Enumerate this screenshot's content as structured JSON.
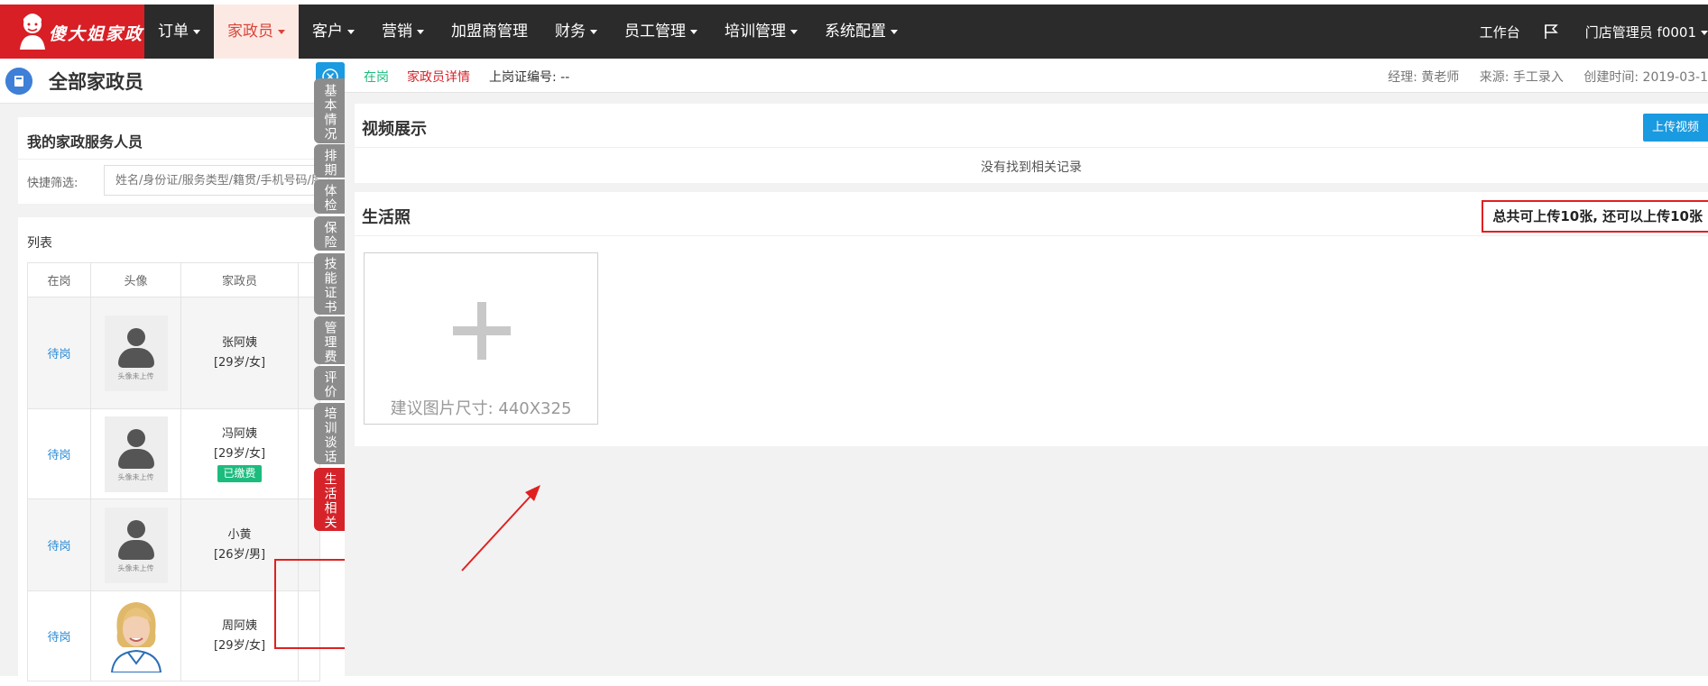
{
  "nav": {
    "brand": "傻大姐家政",
    "items": [
      {
        "label": "订单",
        "caret": true,
        "active": false
      },
      {
        "label": "家政员",
        "caret": true,
        "active": true
      },
      {
        "label": "客户",
        "caret": true,
        "active": false
      },
      {
        "label": "营销",
        "caret": true,
        "active": false
      },
      {
        "label": "加盟商管理",
        "caret": false,
        "active": false
      },
      {
        "label": "财务",
        "caret": true,
        "active": false
      },
      {
        "label": "员工管理",
        "caret": true,
        "active": false
      },
      {
        "label": "培训管理",
        "caret": true,
        "active": false
      },
      {
        "label": "系统配置",
        "caret": true,
        "active": false
      }
    ],
    "workbench": "工作台",
    "user": "门店管理员 f0001"
  },
  "left": {
    "title": "全部家政员",
    "section_title": "我的家政服务人员",
    "filter_label": "快捷筛选:",
    "filter_placeholder": "姓名/身份证/服务类型/籍贯/手机号码/层",
    "list_title": "列表",
    "columns": [
      "在岗",
      "头像",
      "家政员"
    ],
    "avatar_placeholder": "头像未上传",
    "rows": [
      {
        "status": "待岗",
        "name": "张阿姨",
        "info": "[29岁/女]",
        "badge": "",
        "photo": false
      },
      {
        "status": "待岗",
        "name": "冯阿姨",
        "info": "[29岁/女]",
        "badge": "已缴费",
        "photo": false
      },
      {
        "status": "待岗",
        "name": "小黄",
        "info": "[26岁/男]",
        "badge": "",
        "photo": false
      },
      {
        "status": "待岗",
        "name": "周阿姨",
        "info": "[29岁/女]",
        "badge": "",
        "photo": true
      }
    ]
  },
  "tabs": [
    {
      "label": "基本情况",
      "active": false
    },
    {
      "label": "排期",
      "active": false
    },
    {
      "label": "体检",
      "active": false
    },
    {
      "label": "保险",
      "active": false
    },
    {
      "label": "技能证书",
      "active": false
    },
    {
      "label": "管理费",
      "active": false
    },
    {
      "label": "评价",
      "active": false
    },
    {
      "label": "培训谈话",
      "active": false
    },
    {
      "label": "生活相关",
      "active": true
    }
  ],
  "detail": {
    "status": "在岗",
    "page_name": "家政员详情",
    "cert_no": "上岗证编号: --",
    "manager": "经理: 黄老师",
    "source": "来源: 手工录入",
    "created": "创建时间: 2019-03-1"
  },
  "video": {
    "title": "视频展示",
    "upload_button": "上传视频",
    "empty_text": "没有找到相关记录"
  },
  "photos": {
    "title": "生活照",
    "quota": "总共可上传10张, 还可以上传10张",
    "upload_hint": "建议图片尺寸: 440X325"
  },
  "colors": {
    "brand_red": "#d81f26",
    "topbar": "#2b2b2b",
    "accent_blue": "#1a9ae0",
    "status_green": "#1bbc7d",
    "highlight_red": "#e02020"
  }
}
